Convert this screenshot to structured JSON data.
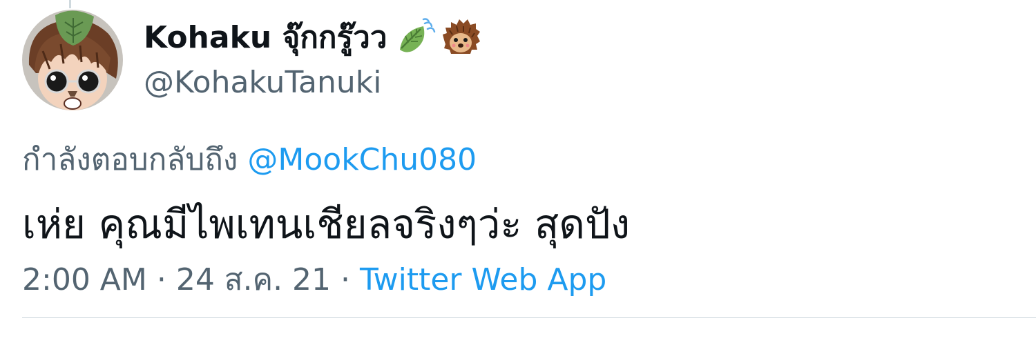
{
  "author": {
    "display_name": "Kohaku จุ๊กกรู๊วว",
    "name_emojis": [
      "leaf-fluttering-in-wind-icon",
      "hedgehog-icon"
    ],
    "handle": "@KohakuTanuki"
  },
  "reply": {
    "prefix": "กำลังตอบกลับถึง",
    "mention": "@MookChu080"
  },
  "tweet": {
    "text": "เห่ย คุณมีไพเทนเชียลจริงๆว่ะ สุดปัง"
  },
  "meta": {
    "time": "2:00 AM",
    "separator_1": " · ",
    "date": "24 ส.ค. 21",
    "separator_2": " · ",
    "source": "Twitter Web App"
  },
  "colors": {
    "text_primary": "#0f1419",
    "text_secondary": "#536471",
    "link": "#1d9bf0",
    "divider": "#cfd9de"
  }
}
